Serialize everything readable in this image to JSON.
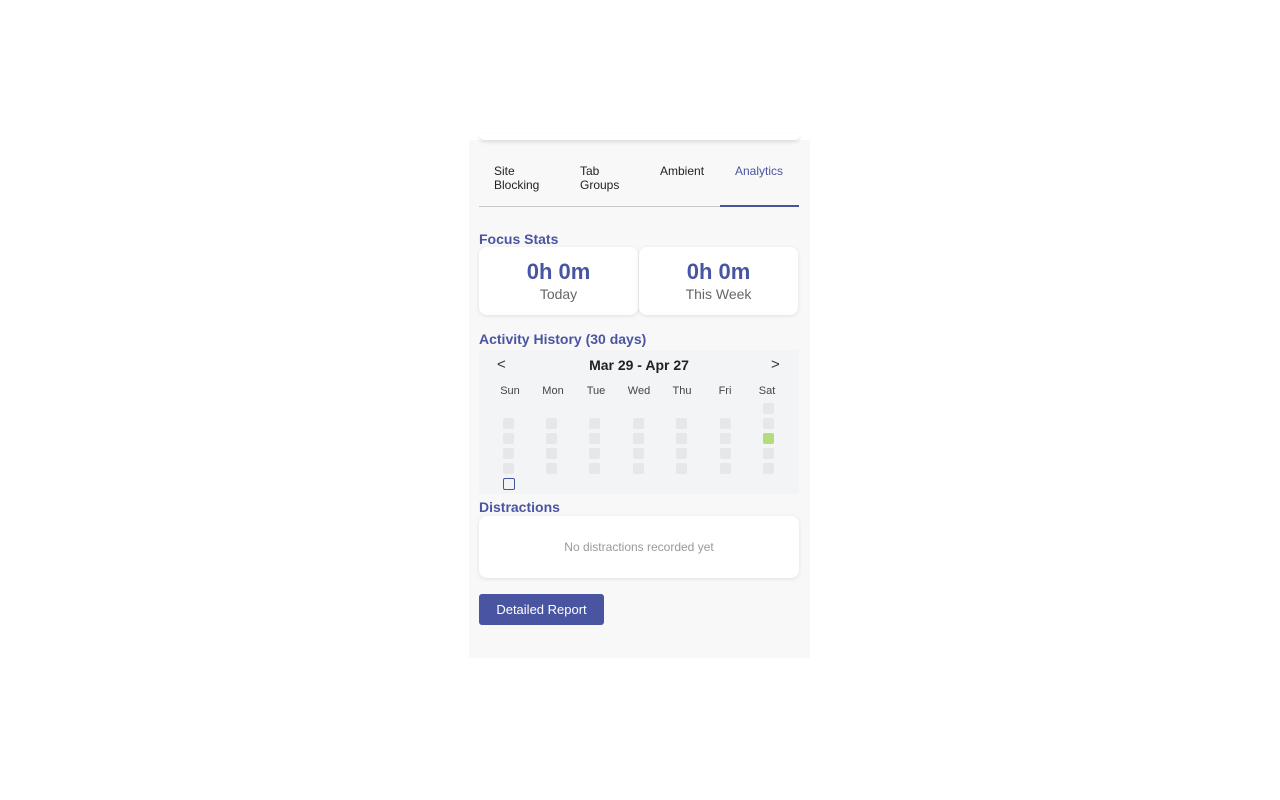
{
  "tabs": {
    "site_blocking": "Site Blocking",
    "tab_groups": "Tab Groups",
    "ambient": "Ambient",
    "analytics": "Analytics"
  },
  "focus_stats": {
    "title": "Focus Stats",
    "today_value": "0h 0m",
    "today_label": "Today",
    "week_value": "0h 0m",
    "week_label": "This Week"
  },
  "activity": {
    "title": "Activity History (30 days)",
    "prev": "<",
    "next": ">",
    "range": "Mar 29 - Apr 27",
    "weekdays": [
      "Sun",
      "Mon",
      "Tue",
      "Wed",
      "Thu",
      "Fri",
      "Sat"
    ],
    "active_day_color": "#b3dc7a",
    "empty_day_color": "#e6e7ea"
  },
  "distractions": {
    "title": "Distractions",
    "empty_text": "No distractions recorded yet"
  },
  "report_button": "Detailed Report",
  "colors": {
    "accent": "#4a55a2"
  }
}
